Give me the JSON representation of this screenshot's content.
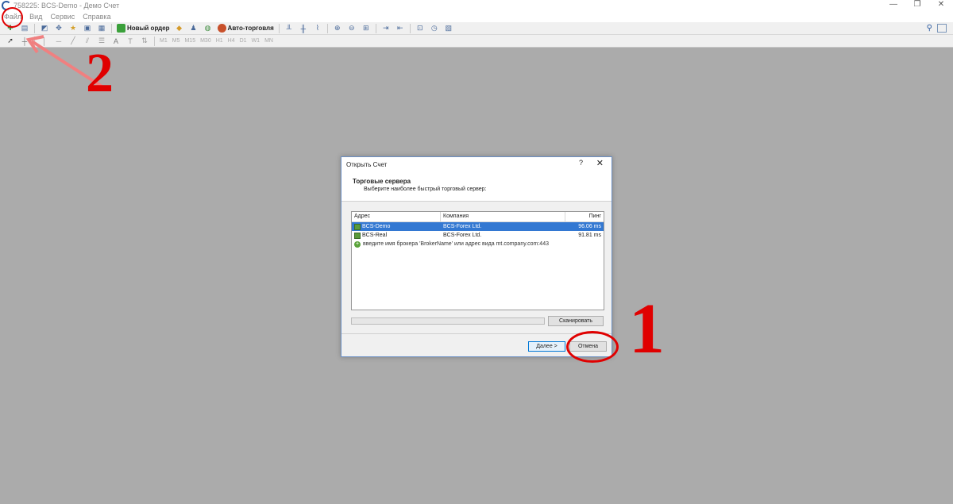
{
  "window": {
    "title": "758225: BCS-Demo - Демо Счет",
    "controls": [
      "—",
      "❐",
      "✕"
    ]
  },
  "menu": [
    "Файл",
    "Вид",
    "Сервис",
    "Справка"
  ],
  "toolbar": {
    "new_order": "Новый ордер",
    "auto_trading": "Авто-торговля"
  },
  "timeframes": [
    "M1",
    "M5",
    "M15",
    "M30",
    "H1",
    "H4",
    "D1",
    "W1",
    "MN"
  ],
  "dialog": {
    "title": "Открыть Счет",
    "help": "?",
    "close": "✕",
    "heading": "Торговые сервера",
    "subheading": "Выберите наиболее быстрый торговый сервер:",
    "columns": [
      "Адрес",
      "Компания",
      "Пинг"
    ],
    "rows": [
      {
        "address": "BCS-Demo",
        "company": "BCS-Forex Ltd.",
        "ping": "96.06 ms",
        "selected": true
      },
      {
        "address": "BCS-Real",
        "company": "BCS-Forex Ltd.",
        "ping": "91.81 ms",
        "selected": false
      }
    ],
    "hint": "введите имя брокера 'BrokerName' или адрес вида mt.company.com:443",
    "scan_label": "Сканировать",
    "next_label": "Далее >",
    "cancel_label": "Отмена"
  },
  "annotations": {
    "step1": "1",
    "step2": "2",
    "color": "#e00000"
  },
  "colors": {
    "workspace": "#ababab",
    "selection": "#3378d2"
  }
}
